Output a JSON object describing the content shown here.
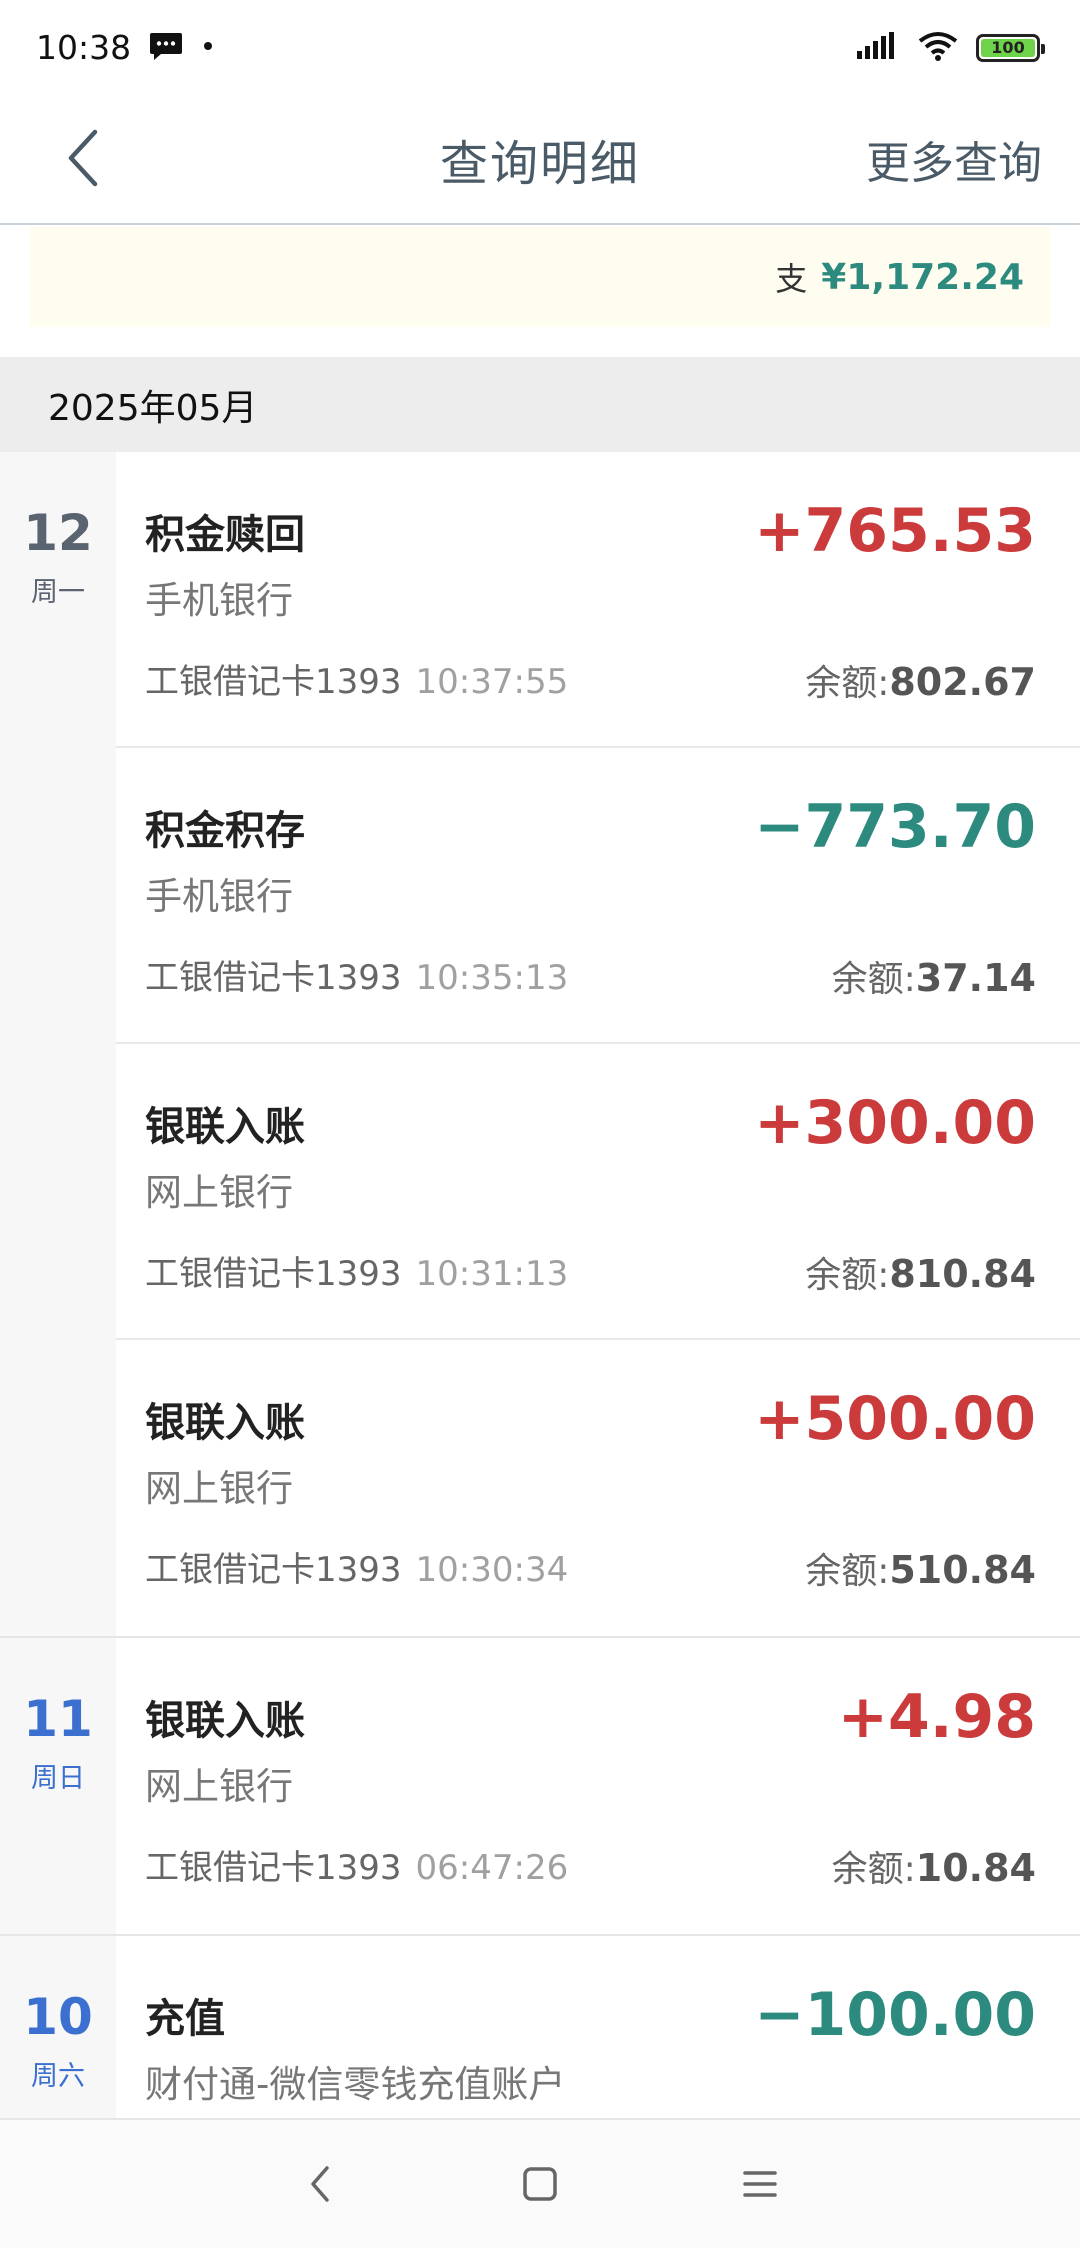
{
  "status_bar": {
    "time": "10:38",
    "battery": "100",
    "icons": [
      "message-icon",
      "dot-icon",
      "signal-icon",
      "wifi-icon",
      "battery-icon"
    ]
  },
  "header": {
    "title": "查询明细",
    "more_label": "更多查询"
  },
  "summary": {
    "label": "支",
    "amount": "¥1,172.24"
  },
  "month": "2025年05月",
  "colors": {
    "income": "#cc3b3b",
    "expense": "#2d8a7e",
    "day_sunday": "#3b6fd0",
    "day_weekday": "#5a6470"
  },
  "groups": [
    {
      "day": "12",
      "week": "周一",
      "day_color": "#5a6470",
      "entries": [
        {
          "title": "积金赎回",
          "channel": "手机银行",
          "card": "工银借记卡1393",
          "time": "10:37:55",
          "amount": "+765.53",
          "type": "income",
          "balance_label": "余额:",
          "balance": "802.67"
        },
        {
          "title": "积金积存",
          "channel": "手机银行",
          "card": "工银借记卡1393",
          "time": "10:35:13",
          "amount": "−773.70",
          "type": "expense",
          "balance_label": "余额:",
          "balance": "37.14"
        },
        {
          "title": "银联入账",
          "channel": "网上银行",
          "card": "工银借记卡1393",
          "time": "10:31:13",
          "amount": "+300.00",
          "type": "income",
          "balance_label": "余额:",
          "balance": "810.84"
        },
        {
          "title": "银联入账",
          "channel": "网上银行",
          "card": "工银借记卡1393",
          "time": "10:30:34",
          "amount": "+500.00",
          "type": "income",
          "balance_label": "余额:",
          "balance": "510.84"
        }
      ]
    },
    {
      "day": "11",
      "week": "周日",
      "day_color": "#3b6fd0",
      "entries": [
        {
          "title": "银联入账",
          "channel": "网上银行",
          "card": "工银借记卡1393",
          "time": "06:47:26",
          "amount": "+4.98",
          "type": "income",
          "balance_label": "余额:",
          "balance": "10.84"
        }
      ]
    },
    {
      "day": "10",
      "week": "周六",
      "day_color": "#3b6fd0",
      "entries": [
        {
          "title": "充值",
          "channel": "财付通-微信零钱充值账户",
          "card": "",
          "time": "",
          "amount": "−100.00",
          "type": "expense",
          "balance_label": "",
          "balance": ""
        }
      ]
    }
  ]
}
